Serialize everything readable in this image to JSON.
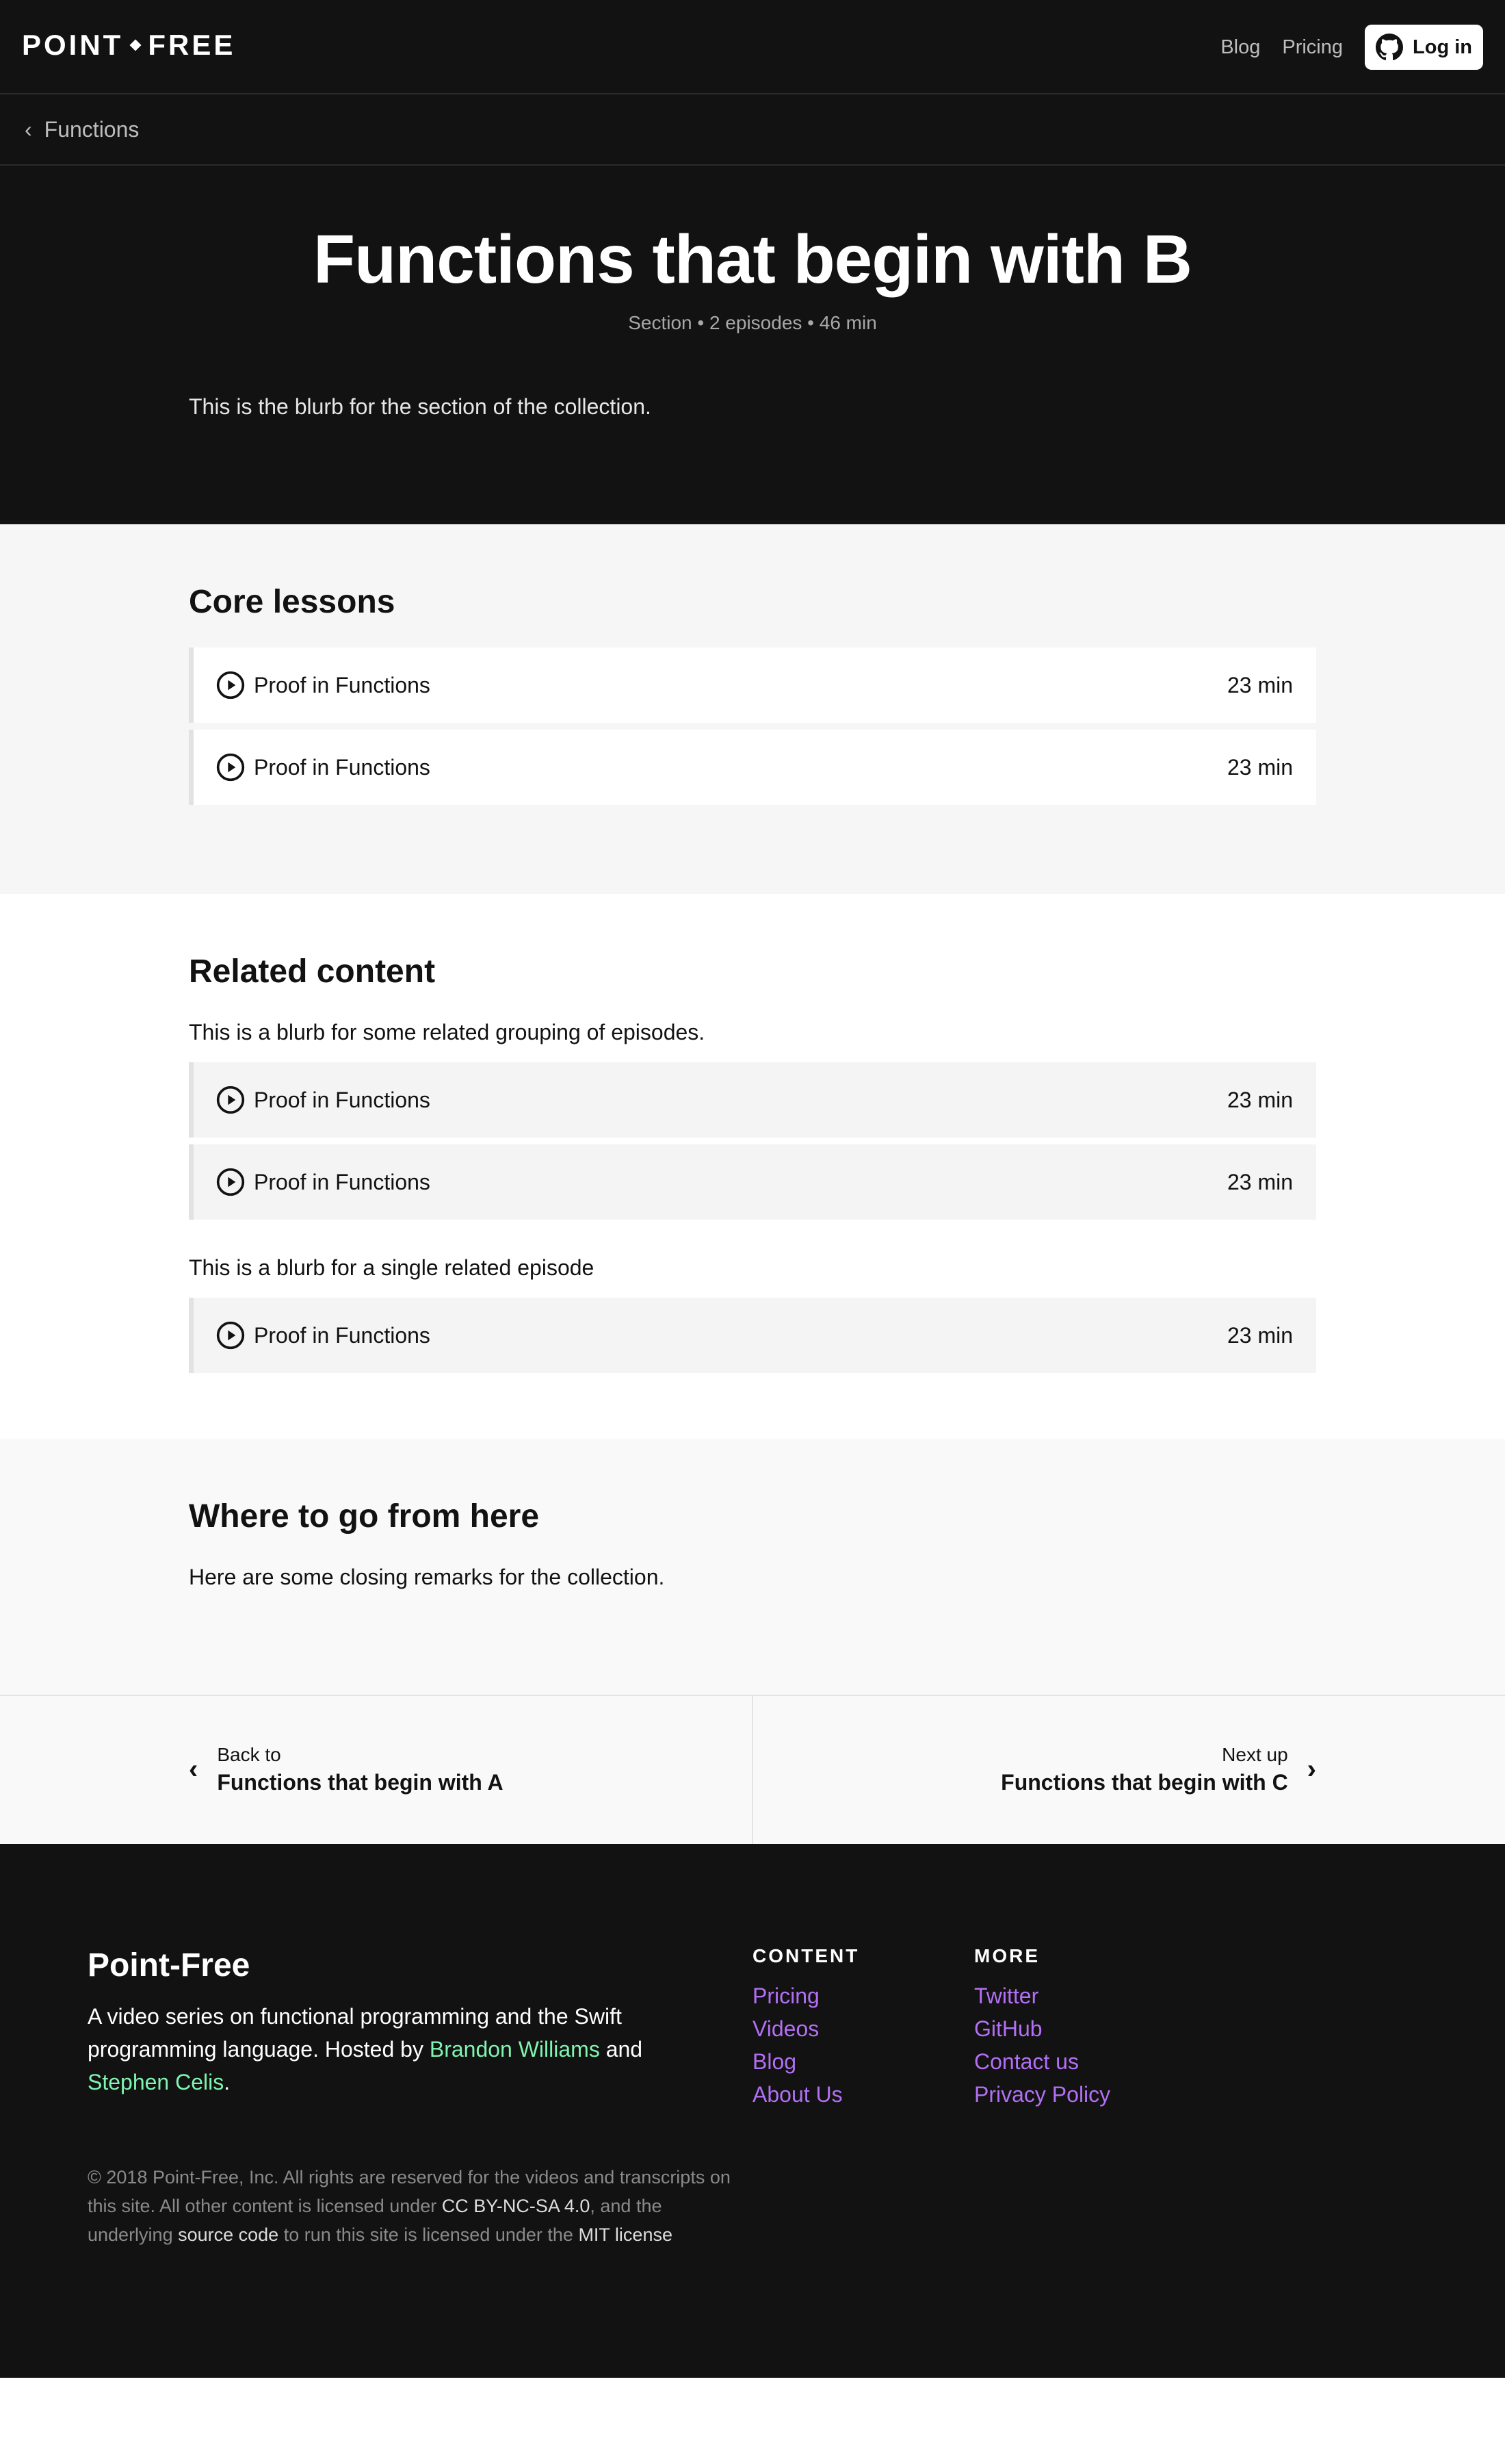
{
  "nav": {
    "logo_left": "POINT",
    "logo_right": "FREE",
    "links": [
      "Blog",
      "Pricing"
    ],
    "login_label": "Log in"
  },
  "breadcrumb": {
    "label": "Functions"
  },
  "hero": {
    "title": "Functions that begin with B",
    "meta": "Section • 2 episodes • 46 min",
    "blurb": "This is the blurb for the section of the collection."
  },
  "core": {
    "heading": "Core lessons",
    "items": [
      {
        "title": "Proof in Functions",
        "duration": "23 min"
      },
      {
        "title": "Proof in Functions",
        "duration": "23 min"
      }
    ]
  },
  "related": {
    "heading": "Related content",
    "group_blurb": "This is a blurb for some related grouping of episodes.",
    "group_items": [
      {
        "title": "Proof in Functions",
        "duration": "23 min"
      },
      {
        "title": "Proof in Functions",
        "duration": "23 min"
      }
    ],
    "single_blurb": "This is a blurb for a single related episode",
    "single_items": [
      {
        "title": "Proof in Functions",
        "duration": "23 min"
      }
    ]
  },
  "where": {
    "heading": "Where to go from here",
    "text": "Here are some closing remarks for the collection."
  },
  "prevnext": {
    "prev_small": "Back to",
    "prev_title": "Functions that begin with A",
    "next_small": "Next up",
    "next_title": "Functions that begin with C"
  },
  "footer": {
    "brand": "Point-Free",
    "desc_1": "A video series on functional programming and the Swift programming language. Hosted by ",
    "host_1": "Brandon Williams",
    "desc_2": " and ",
    "host_2": "Stephen Celis",
    "desc_3": ".",
    "content_head": "CONTENT",
    "content_links": [
      "Pricing",
      "Videos",
      "Blog",
      "About Us"
    ],
    "more_head": "MORE",
    "more_links": [
      "Twitter",
      "GitHub",
      "Contact us",
      "Privacy Policy"
    ],
    "copy_1": "© 2018 Point-Free, Inc. All rights are reserved for the videos and transcripts on this site. All other content is licensed under ",
    "copy_license": "CC BY-NC-SA 4.0",
    "copy_2": ", and the underlying ",
    "copy_source": "source code",
    "copy_3": " to run this site is licensed under the ",
    "copy_mit": "MIT license"
  },
  "colors": {
    "dark": "#121212",
    "link_purple": "#b36ff5",
    "host_green": "#7ff5b0"
  }
}
